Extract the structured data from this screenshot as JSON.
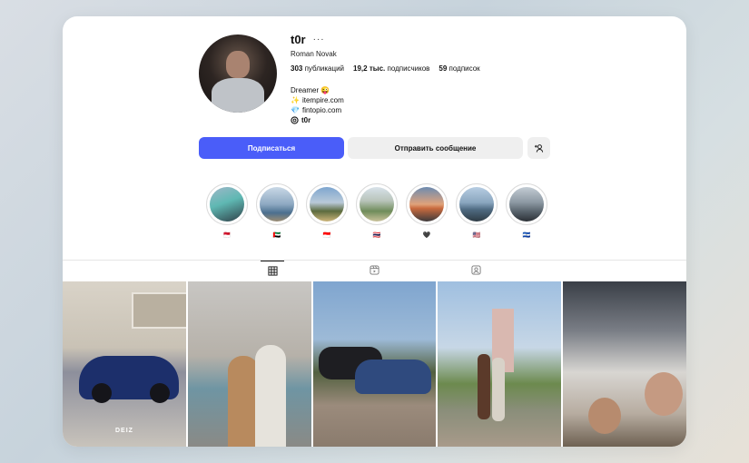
{
  "profile": {
    "username": "t0r",
    "more_label": "···",
    "full_name": "Roman Novak",
    "stats": [
      {
        "count": "303",
        "label": "публикаций"
      },
      {
        "count": "19,2 тыс.",
        "label": "подписчиков"
      },
      {
        "count": "59",
        "label": "подписок"
      }
    ],
    "bio": {
      "tagline": "Dreamer 😜",
      "link1_icon": "✨",
      "link1": "itempire.com",
      "link2_icon": "💎",
      "link2": "fintopio.com",
      "threads": "t0r"
    }
  },
  "actions": {
    "follow_label": "Подписаться",
    "message_label": "Отправить сообщение",
    "add_user_icon": "add-user-icon"
  },
  "highlights": [
    {
      "flag": "🇲🇨"
    },
    {
      "flag": "🇦🇪"
    },
    {
      "flag": "🇮🇩"
    },
    {
      "flag": "🇹🇭"
    },
    {
      "flag": "🖤"
    },
    {
      "flag": "🇺🇸"
    },
    {
      "flag": "🇸🇻"
    }
  ],
  "tabs": [
    "posts-grid-icon",
    "reels-icon",
    "tagged-icon"
  ],
  "posts": [
    {
      "watermark": "DEIZ"
    }
  ],
  "colors": {
    "accent": "#4a5df9",
    "secondary_button": "#efefef"
  }
}
